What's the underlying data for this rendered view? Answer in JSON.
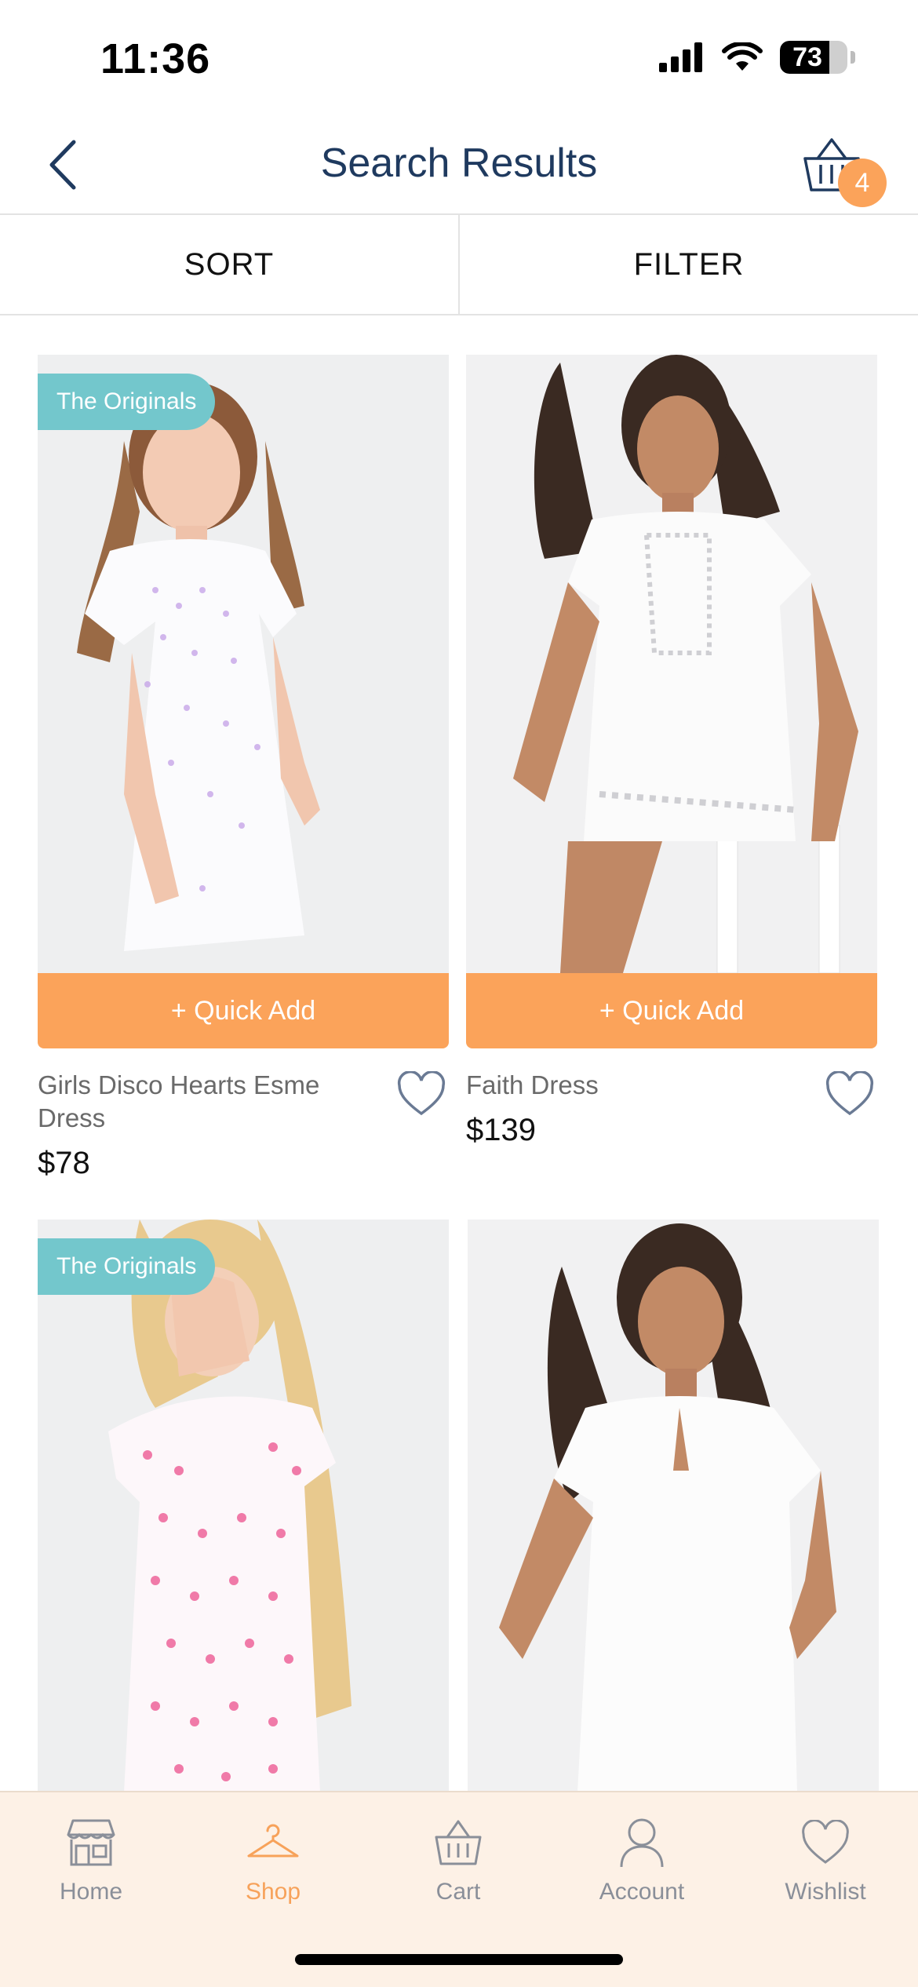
{
  "status_bar": {
    "time": "11:36",
    "battery": "73"
  },
  "header": {
    "title": "Search Results",
    "cart_count": "4"
  },
  "toolbar": {
    "sort_label": "SORT",
    "filter_label": "FILTER"
  },
  "products": [
    {
      "tag": "The Originals",
      "quick_add": "+ Quick Add",
      "name": "Girls Disco Hearts Esme Dress",
      "price": "$78"
    },
    {
      "tag": "",
      "quick_add": "+ Quick Add",
      "name": "Faith Dress",
      "price": "$139"
    },
    {
      "tag": "The Originals"
    },
    {
      "tag": ""
    }
  ],
  "tabs": [
    {
      "label": "Home",
      "icon": "store-icon"
    },
    {
      "label": "Shop",
      "icon": "hanger-icon",
      "active": true
    },
    {
      "label": "Cart",
      "icon": "basket-icon"
    },
    {
      "label": "Account",
      "icon": "person-icon"
    },
    {
      "label": "Wishlist",
      "icon": "heart-icon"
    }
  ],
  "colors": {
    "accent": "#fba35a",
    "tag": "#73c7cc",
    "title": "#1f3a5f",
    "tabbar_bg": "#fdf1e6"
  }
}
